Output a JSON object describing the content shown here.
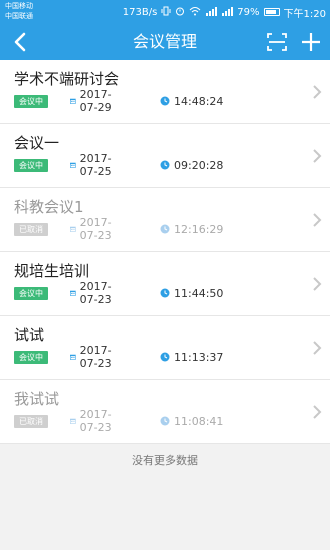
{
  "status": {
    "carrier1": "中国移动",
    "carrier2": "中国联通",
    "speed": "173B/s",
    "battery": "79%",
    "time": "下午1:20"
  },
  "navbar": {
    "title": "会议管理",
    "back_icon": "back-arrow-icon",
    "scan_icon": "scan-icon",
    "add_icon": "plus-icon"
  },
  "meetings": [
    {
      "title": "学术不端研讨会",
      "status": "会议中",
      "date": "2017-07-29",
      "time": "14:48:24"
    },
    {
      "title": "会议一",
      "status": "会议中",
      "date": "2017-07-25",
      "time": "09:20:28"
    },
    {
      "title": "科教会议1",
      "status": "已取消",
      "date": "2017-07-23",
      "time": "12:16:29"
    },
    {
      "title": "规培生培训",
      "status": "会议中",
      "date": "2017-07-23",
      "time": "11:44:50"
    },
    {
      "title": "试试",
      "status": "会议中",
      "date": "2017-07-23",
      "time": "11:13:37"
    },
    {
      "title": "我试试",
      "status": "已取消",
      "date": "2017-07-23",
      "time": "11:08:41"
    }
  ],
  "footer": "没有更多数据",
  "colors": {
    "primary": "#2e9fe4",
    "active": "#3cba78",
    "cancelled": "#cfcfcf"
  }
}
